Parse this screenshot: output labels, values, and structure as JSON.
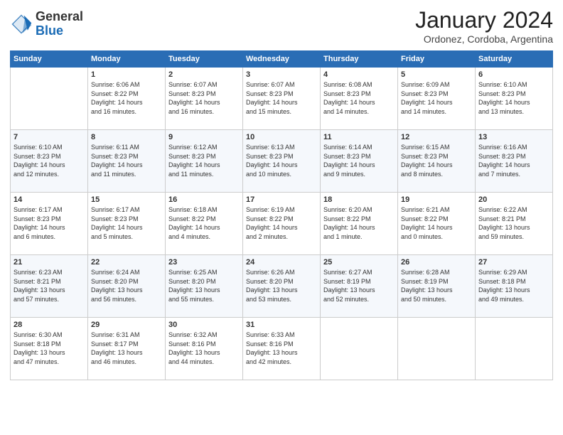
{
  "header": {
    "logo_general": "General",
    "logo_blue": "Blue",
    "month_title": "January 2024",
    "location": "Ordonez, Cordoba, Argentina"
  },
  "weekdays": [
    "Sunday",
    "Monday",
    "Tuesday",
    "Wednesday",
    "Thursday",
    "Friday",
    "Saturday"
  ],
  "weeks": [
    [
      {
        "day": "",
        "info": ""
      },
      {
        "day": "1",
        "info": "Sunrise: 6:06 AM\nSunset: 8:22 PM\nDaylight: 14 hours\nand 16 minutes."
      },
      {
        "day": "2",
        "info": "Sunrise: 6:07 AM\nSunset: 8:23 PM\nDaylight: 14 hours\nand 16 minutes."
      },
      {
        "day": "3",
        "info": "Sunrise: 6:07 AM\nSunset: 8:23 PM\nDaylight: 14 hours\nand 15 minutes."
      },
      {
        "day": "4",
        "info": "Sunrise: 6:08 AM\nSunset: 8:23 PM\nDaylight: 14 hours\nand 14 minutes."
      },
      {
        "day": "5",
        "info": "Sunrise: 6:09 AM\nSunset: 8:23 PM\nDaylight: 14 hours\nand 14 minutes."
      },
      {
        "day": "6",
        "info": "Sunrise: 6:10 AM\nSunset: 8:23 PM\nDaylight: 14 hours\nand 13 minutes."
      }
    ],
    [
      {
        "day": "7",
        "info": "Sunrise: 6:10 AM\nSunset: 8:23 PM\nDaylight: 14 hours\nand 12 minutes."
      },
      {
        "day": "8",
        "info": "Sunrise: 6:11 AM\nSunset: 8:23 PM\nDaylight: 14 hours\nand 11 minutes."
      },
      {
        "day": "9",
        "info": "Sunrise: 6:12 AM\nSunset: 8:23 PM\nDaylight: 14 hours\nand 11 minutes."
      },
      {
        "day": "10",
        "info": "Sunrise: 6:13 AM\nSunset: 8:23 PM\nDaylight: 14 hours\nand 10 minutes."
      },
      {
        "day": "11",
        "info": "Sunrise: 6:14 AM\nSunset: 8:23 PM\nDaylight: 14 hours\nand 9 minutes."
      },
      {
        "day": "12",
        "info": "Sunrise: 6:15 AM\nSunset: 8:23 PM\nDaylight: 14 hours\nand 8 minutes."
      },
      {
        "day": "13",
        "info": "Sunrise: 6:16 AM\nSunset: 8:23 PM\nDaylight: 14 hours\nand 7 minutes."
      }
    ],
    [
      {
        "day": "14",
        "info": "Sunrise: 6:17 AM\nSunset: 8:23 PM\nDaylight: 14 hours\nand 6 minutes."
      },
      {
        "day": "15",
        "info": "Sunrise: 6:17 AM\nSunset: 8:23 PM\nDaylight: 14 hours\nand 5 minutes."
      },
      {
        "day": "16",
        "info": "Sunrise: 6:18 AM\nSunset: 8:22 PM\nDaylight: 14 hours\nand 4 minutes."
      },
      {
        "day": "17",
        "info": "Sunrise: 6:19 AM\nSunset: 8:22 PM\nDaylight: 14 hours\nand 2 minutes."
      },
      {
        "day": "18",
        "info": "Sunrise: 6:20 AM\nSunset: 8:22 PM\nDaylight: 14 hours\nand 1 minute."
      },
      {
        "day": "19",
        "info": "Sunrise: 6:21 AM\nSunset: 8:22 PM\nDaylight: 14 hours\nand 0 minutes."
      },
      {
        "day": "20",
        "info": "Sunrise: 6:22 AM\nSunset: 8:21 PM\nDaylight: 13 hours\nand 59 minutes."
      }
    ],
    [
      {
        "day": "21",
        "info": "Sunrise: 6:23 AM\nSunset: 8:21 PM\nDaylight: 13 hours\nand 57 minutes."
      },
      {
        "day": "22",
        "info": "Sunrise: 6:24 AM\nSunset: 8:20 PM\nDaylight: 13 hours\nand 56 minutes."
      },
      {
        "day": "23",
        "info": "Sunrise: 6:25 AM\nSunset: 8:20 PM\nDaylight: 13 hours\nand 55 minutes."
      },
      {
        "day": "24",
        "info": "Sunrise: 6:26 AM\nSunset: 8:20 PM\nDaylight: 13 hours\nand 53 minutes."
      },
      {
        "day": "25",
        "info": "Sunrise: 6:27 AM\nSunset: 8:19 PM\nDaylight: 13 hours\nand 52 minutes."
      },
      {
        "day": "26",
        "info": "Sunrise: 6:28 AM\nSunset: 8:19 PM\nDaylight: 13 hours\nand 50 minutes."
      },
      {
        "day": "27",
        "info": "Sunrise: 6:29 AM\nSunset: 8:18 PM\nDaylight: 13 hours\nand 49 minutes."
      }
    ],
    [
      {
        "day": "28",
        "info": "Sunrise: 6:30 AM\nSunset: 8:18 PM\nDaylight: 13 hours\nand 47 minutes."
      },
      {
        "day": "29",
        "info": "Sunrise: 6:31 AM\nSunset: 8:17 PM\nDaylight: 13 hours\nand 46 minutes."
      },
      {
        "day": "30",
        "info": "Sunrise: 6:32 AM\nSunset: 8:16 PM\nDaylight: 13 hours\nand 44 minutes."
      },
      {
        "day": "31",
        "info": "Sunrise: 6:33 AM\nSunset: 8:16 PM\nDaylight: 13 hours\nand 42 minutes."
      },
      {
        "day": "",
        "info": ""
      },
      {
        "day": "",
        "info": ""
      },
      {
        "day": "",
        "info": ""
      }
    ]
  ]
}
